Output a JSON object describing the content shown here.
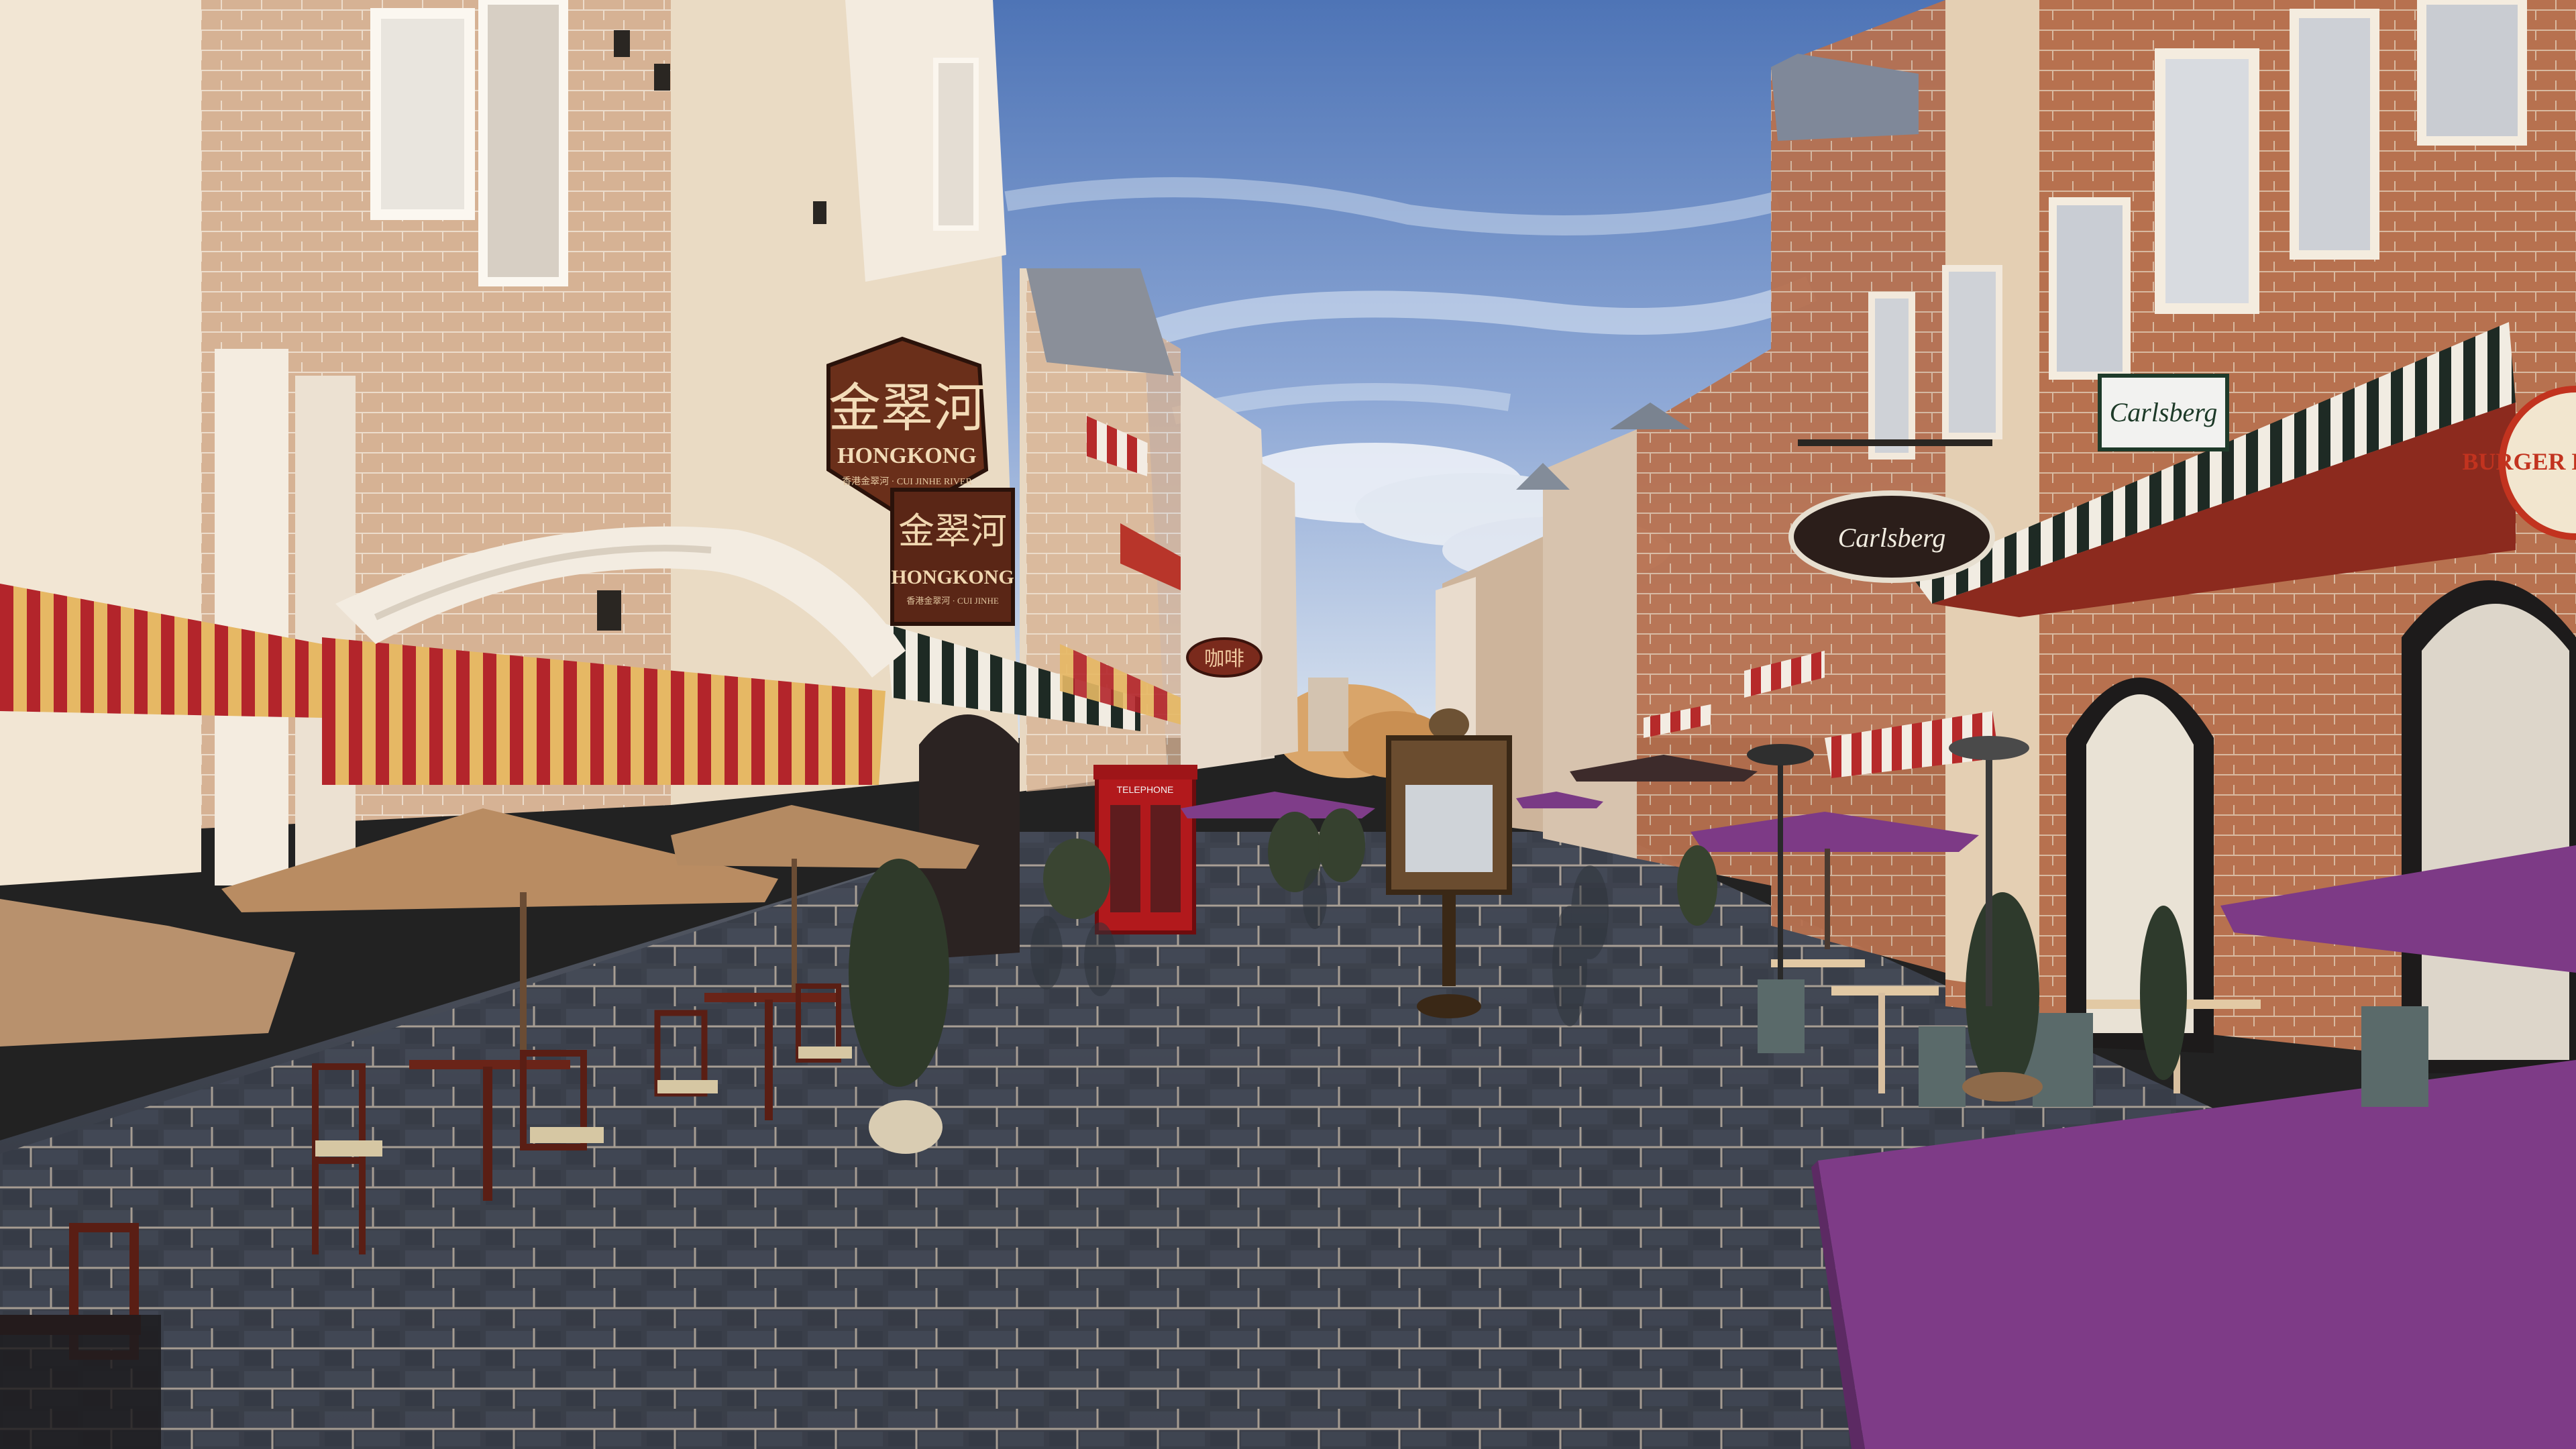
{
  "scene": {
    "description_free": true
  },
  "signs": {
    "hex_sign_chinese": "金翠河",
    "hex_sign_english": "HONGKONG",
    "hex_sign_small": "香港金翠河 · CUI JINHE RIVER",
    "board_sign_chinese": "金翠河",
    "board_sign_english": "HONGKONG",
    "board_sign_small": "香港金翠河 · CUI JINHE",
    "carlsberg_top": "Carlsberg",
    "carlsberg_hanging": "Carlsberg",
    "burger_king": "BURGER KING",
    "telephone_box": "TELEPHONE",
    "cafe_small_sign": "咖啡"
  },
  "colors": {
    "sky_top": "#5b7fbf",
    "sky_bottom": "#c9d9ee",
    "cobblestone": "#3a3f4a",
    "awning_red": "#b5262a",
    "awning_yellow": "#e2b25a",
    "umbrella_tan": "#b98c62",
    "umbrella_purple": "#7d3a86",
    "brick": "#b86f4c",
    "facade_cream": "#efe2cf",
    "phone_box_red": "#b2191c"
  }
}
